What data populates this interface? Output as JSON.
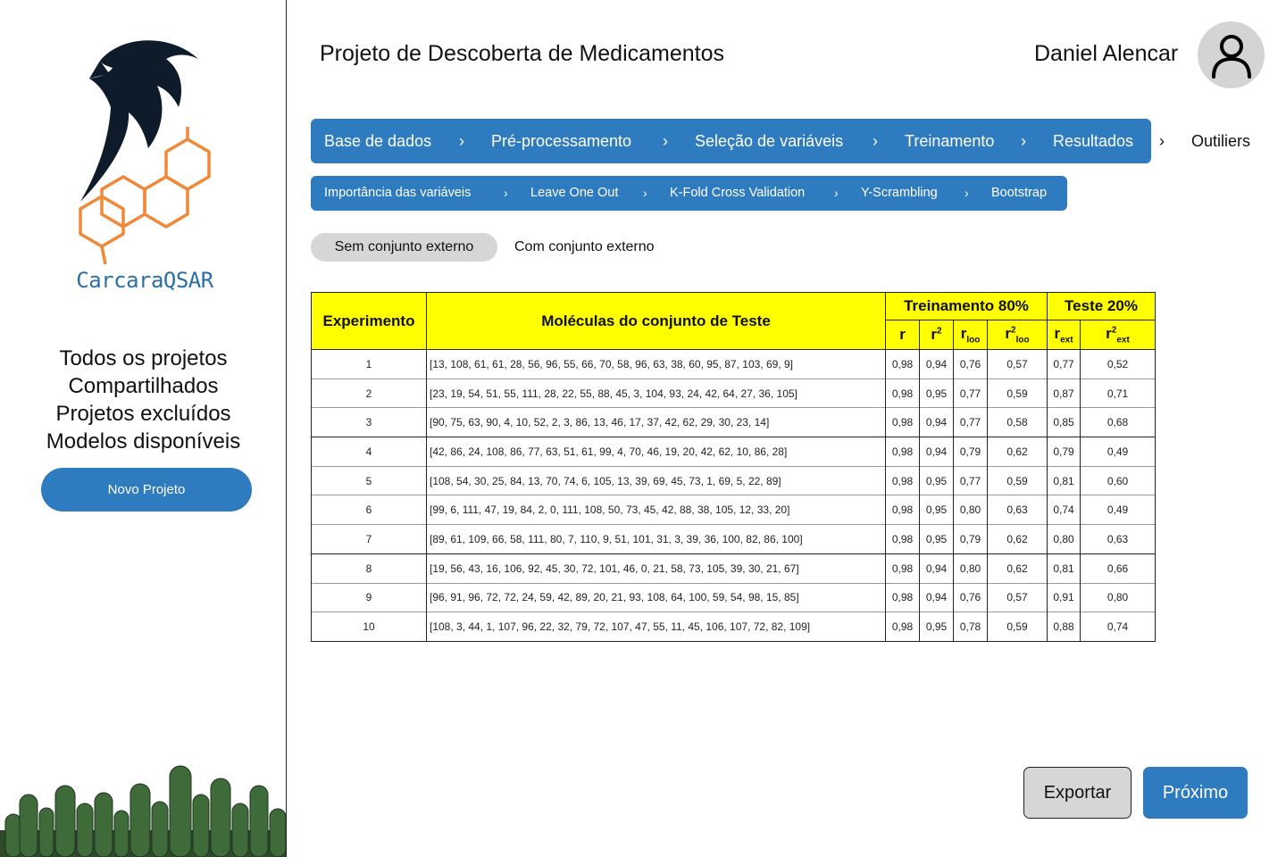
{
  "app": {
    "logo_text": "CarcaraQSAR"
  },
  "sidebar": {
    "nav": [
      "Todos os projetos",
      "Compartilhados",
      "Projetos excluídos",
      "Modelos disponíveis"
    ],
    "new_project_label": "Novo Projeto"
  },
  "header": {
    "title": "Projeto de Descoberta de Medicamentos",
    "user_name": "Daniel Alencar"
  },
  "breadcrumb": {
    "steps": [
      "Base de dados",
      "Pré-processamento",
      "Seleção de variáveis",
      "Treinamento",
      "Resultados",
      "Outiliers"
    ]
  },
  "subnav": {
    "items": [
      "Importância das variáveis",
      "Leave One Out",
      "K-Fold Cross Validation",
      "Y-Scrambling",
      "Bootstrap"
    ]
  },
  "toggle": {
    "active": "Sem conjunto externo",
    "inactive": "Com conjunto externo"
  },
  "table": {
    "headers": {
      "experiment": "Experimento",
      "molecules": "Moléculas do conjunto de Teste",
      "train_group": "Treinamento 80%",
      "test_group": "Teste 20%",
      "r": "r",
      "r2": "r",
      "r2_sup": "2",
      "rloo": "r",
      "rloo_sub": "loo",
      "r2loo": "r",
      "r2loo_sup": "2",
      "r2loo_sub": "loo",
      "rext": "r",
      "rext_sub": "ext",
      "r2ext": "r",
      "r2ext_sup": "2",
      "r2ext_sub": "ext"
    },
    "rows": [
      {
        "exp": "1",
        "mol": "[13, 108, 61, 61, 28, 56, 96, 55, 66, 70, 58, 96, 63, 38, 60, 95, 87, 103, 69, 9]",
        "r": "0,98",
        "r2": "0,94",
        "rloo": "0,76",
        "r2loo": "0,57",
        "rext": "0,77",
        "r2ext": "0,52"
      },
      {
        "exp": "2",
        "mol": "[23, 19, 54, 51, 55, 111, 28, 22, 55, 88, 45, 3, 104, 93, 24, 42, 64, 27, 36, 105]",
        "r": "0,98",
        "r2": "0,95",
        "rloo": "0,77",
        "r2loo": "0,59",
        "rext": "0,87",
        "r2ext": "0,71"
      },
      {
        "exp": "3",
        "mol": "[90, 75, 63, 90, 4, 10, 52, 2, 3, 86, 13, 46, 17, 37, 42, 62, 29, 30, 23, 14]",
        "r": "0,98",
        "r2": "0,94",
        "rloo": "0,77",
        "r2loo": "0,58",
        "rext": "0,85",
        "r2ext": "0,68"
      },
      {
        "exp": "4",
        "mol": "[42, 86, 24, 108, 86, 77, 63, 51, 61, 99, 4, 70, 46, 19, 20, 42, 62, 10, 86, 28]",
        "r": "0,98",
        "r2": "0,94",
        "rloo": "0,79",
        "r2loo": "0,62",
        "rext": "0,79",
        "r2ext": "0,49"
      },
      {
        "exp": "5",
        "mol": "[108, 54, 30, 25, 84, 13, 70, 74, 6, 105, 13, 39, 69, 45, 73, 1, 69, 5, 22, 89]",
        "r": "0,98",
        "r2": "0,95",
        "rloo": "0,77",
        "r2loo": "0,59",
        "rext": "0,81",
        "r2ext": "0,60"
      },
      {
        "exp": "6",
        "mol": "[99, 6, 111, 47, 19, 84, 2, 0, 111, 108, 50, 73, 45, 42, 88, 38, 105, 12, 33, 20]",
        "r": "0,98",
        "r2": "0,95",
        "rloo": "0,80",
        "r2loo": "0,63",
        "rext": "0,74",
        "r2ext": "0,49"
      },
      {
        "exp": "7",
        "mol": "[89, 61, 109, 66, 58, 111, 80, 7, 110, 9, 51, 101, 31, 3, 39, 36, 100, 82, 86, 100]",
        "r": "0,98",
        "r2": "0,95",
        "rloo": "0,79",
        "r2loo": "0,62",
        "rext": "0,80",
        "r2ext": "0,63"
      },
      {
        "exp": "8",
        "mol": "[19, 56, 43, 16, 106, 92, 45, 30, 72, 101, 46, 0, 21, 58, 73, 105, 39, 30, 21, 67]",
        "r": "0,98",
        "r2": "0,94",
        "rloo": "0,80",
        "r2loo": "0,62",
        "rext": "0,81",
        "r2ext": "0,66"
      },
      {
        "exp": "9",
        "mol": "[96, 91, 96, 72, 72, 24, 59, 42, 89, 20, 21, 93, 108, 64, 100, 59, 54, 98, 15, 85]",
        "r": "0,98",
        "r2": "0,94",
        "rloo": "0,76",
        "r2loo": "0,57",
        "rext": "0,91",
        "r2ext": "0,80"
      },
      {
        "exp": "10",
        "mol": "[108, 3, 44, 1, 107, 96, 22, 32, 79, 72, 107, 47, 55, 11, 45, 106, 107, 72, 82, 109]",
        "r": "0,98",
        "r2": "0,95",
        "rloo": "0,78",
        "r2loo": "0,59",
        "rext": "0,88",
        "r2ext": "0,74"
      }
    ]
  },
  "footer": {
    "export_label": "Exportar",
    "next_label": "Próximo"
  },
  "colors": {
    "primary": "#2e7bbf",
    "header_yellow": "#ffff00",
    "logo_orange": "#f0883a",
    "logo_navy": "#0d1b2a"
  }
}
